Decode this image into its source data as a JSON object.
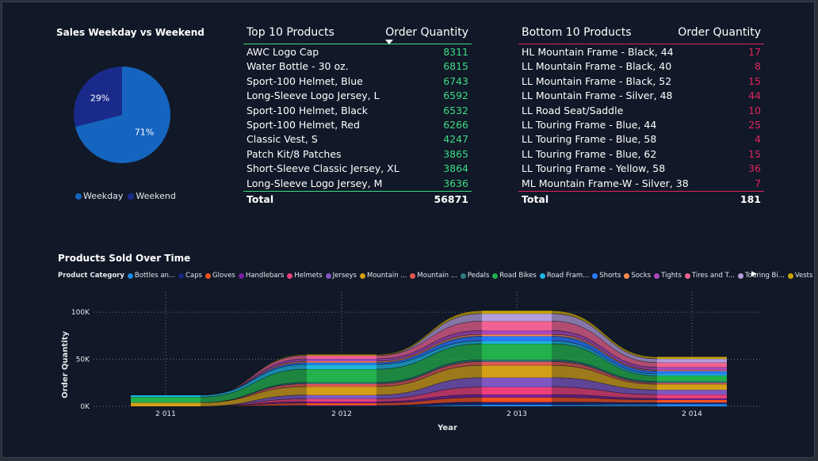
{
  "pie": {
    "title": "Sales Weekday vs Weekend",
    "slices": [
      {
        "name": "Weekday",
        "value": 71,
        "label": "71%",
        "color": "#1565c0"
      },
      {
        "name": "Weekend",
        "value": 29,
        "label": "29%",
        "color": "#1a2a8a"
      }
    ]
  },
  "top10": {
    "title": "Top 10 Products",
    "value_header": "Order Quantity",
    "accent": "#3ddc84",
    "rows": [
      {
        "name": "AWC Logo Cap",
        "value": "8311"
      },
      {
        "name": "Water Bottle - 30 oz.",
        "value": "6815"
      },
      {
        "name": "Sport-100 Helmet, Blue",
        "value": "6743"
      },
      {
        "name": "Long-Sleeve Logo Jersey, L",
        "value": "6592"
      },
      {
        "name": "Sport-100 Helmet, Black",
        "value": "6532"
      },
      {
        "name": "Sport-100 Helmet, Red",
        "value": "6266"
      },
      {
        "name": "Classic Vest, S",
        "value": "4247"
      },
      {
        "name": "Patch Kit/8 Patches",
        "value": "3865"
      },
      {
        "name": "Short-Sleeve Classic Jersey, XL",
        "value": "3864"
      },
      {
        "name": "Long-Sleeve Logo Jersey, M",
        "value": "3636"
      }
    ],
    "total_label": "Total",
    "total_value": "56871"
  },
  "bottom10": {
    "title": "Bottom 10 Products",
    "value_header": "Order Quantity",
    "accent": "#e0245e",
    "rows": [
      {
        "name": "HL Mountain Frame - Black, 44",
        "value": "17"
      },
      {
        "name": "LL Mountain Frame - Black, 40",
        "value": "8"
      },
      {
        "name": "LL Mountain Frame - Black, 52",
        "value": "15"
      },
      {
        "name": "LL Mountain Frame - Silver, 48",
        "value": "44"
      },
      {
        "name": "LL Road Seat/Saddle",
        "value": "10"
      },
      {
        "name": "LL Touring Frame - Blue, 44",
        "value": "25"
      },
      {
        "name": "LL Touring Frame - Blue, 58",
        "value": "4"
      },
      {
        "name": "LL Touring Frame - Blue, 62",
        "value": "15"
      },
      {
        "name": "LL Touring Frame - Yellow, 58",
        "value": "36"
      },
      {
        "name": "ML Mountain Frame-W - Silver, 38",
        "value": "7"
      }
    ],
    "total_label": "Total",
    "total_value": "181"
  },
  "stream": {
    "title": "Products Sold Over Time",
    "legend_title": "Product Category",
    "legend": [
      {
        "label": "Bottles an...",
        "color": "#1e88e5"
      },
      {
        "label": "Caps",
        "color": "#1a237e"
      },
      {
        "label": "Gloves",
        "color": "#f4511e"
      },
      {
        "label": "Handlebars",
        "color": "#7b1fa2"
      },
      {
        "label": "Helmets",
        "color": "#ec407a"
      },
      {
        "label": "Jerseys",
        "color": "#7e57c2"
      },
      {
        "label": "Mountain ...",
        "color": "#d4a017"
      },
      {
        "label": "Mountain ...",
        "color": "#e05555"
      },
      {
        "label": "Pedals",
        "color": "#2e7d7d"
      },
      {
        "label": "Road Bikes",
        "color": "#22b14c"
      },
      {
        "label": "Road Fram...",
        "color": "#1cb5e0"
      },
      {
        "label": "Shorts",
        "color": "#2979ff"
      },
      {
        "label": "Socks",
        "color": "#ff8a50"
      },
      {
        "label": "Tights",
        "color": "#ab47bc"
      },
      {
        "label": "Tires and T...",
        "color": "#f06292"
      },
      {
        "label": "Touring Bi...",
        "color": "#b39ddb"
      },
      {
        "label": "Vests",
        "color": "#c9a400"
      }
    ],
    "scroll_glyph": "▶"
  },
  "chart_data": [
    {
      "type": "pie",
      "title": "Sales Weekday vs Weekend",
      "categories": [
        "Weekday",
        "Weekend"
      ],
      "values": [
        71,
        29
      ],
      "legend": "bottom"
    },
    {
      "type": "area",
      "title": "Products Sold Over Time",
      "xlabel": "Year",
      "ylabel": "Order Quantity",
      "x": [
        "2 011",
        "2 012",
        "2 013",
        "2 014"
      ],
      "yticks": [
        "0K",
        "50K",
        "100K"
      ],
      "ylim": [
        0,
        100000
      ],
      "grid": true,
      "legend": "top",
      "series": [
        {
          "name": "Bottles an...",
          "values": [
            0,
            0,
            2000,
            2500
          ]
        },
        {
          "name": "Caps",
          "values": [
            0,
            1000,
            2500,
            1500
          ]
        },
        {
          "name": "Gloves",
          "values": [
            0,
            2500,
            5000,
            3000
          ]
        },
        {
          "name": "Handlebars",
          "values": [
            0,
            1500,
            3000,
            1500
          ]
        },
        {
          "name": "Helmets",
          "values": [
            0,
            3000,
            8000,
            4000
          ]
        },
        {
          "name": "Jerseys",
          "values": [
            0,
            4000,
            10000,
            5000
          ]
        },
        {
          "name": "Mountain ...",
          "values": [
            4000,
            9000,
            13000,
            6000
          ]
        },
        {
          "name": "Mountain ...",
          "values": [
            0,
            3000,
            4000,
            1500
          ]
        },
        {
          "name": "Pedals",
          "values": [
            0,
            1500,
            2000,
            1500
          ]
        },
        {
          "name": "Road Bikes",
          "values": [
            6000,
            14000,
            17000,
            6000
          ]
        },
        {
          "name": "Road Fram...",
          "values": [
            2000,
            5000,
            3000,
            2000
          ]
        },
        {
          "name": "Shorts",
          "values": [
            0,
            2000,
            5000,
            3000
          ]
        },
        {
          "name": "Socks",
          "values": [
            0,
            1500,
            2000,
            1000
          ]
        },
        {
          "name": "Tights",
          "values": [
            0,
            2500,
            4000,
            3000
          ]
        },
        {
          "name": "Tires and T...",
          "values": [
            0,
            3500,
            10000,
            5000
          ]
        },
        {
          "name": "Touring Bi...",
          "values": [
            0,
            0,
            8000,
            4000
          ]
        },
        {
          "name": "Vests",
          "values": [
            0,
            1000,
            3000,
            2000
          ]
        }
      ]
    }
  ]
}
